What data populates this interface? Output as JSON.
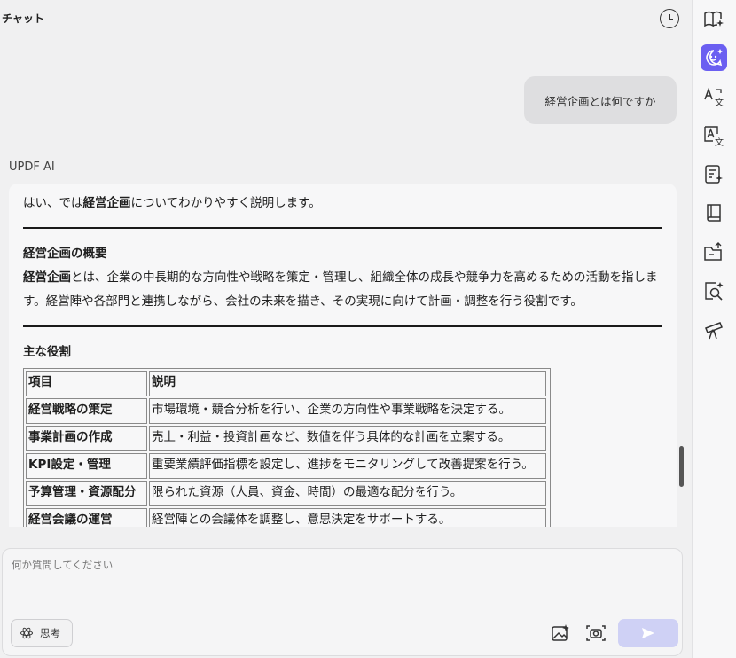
{
  "header": {
    "title": "チャット"
  },
  "conversation": {
    "user_message": "経営企画とは何ですか",
    "ai_name": "UPDF AI",
    "ai_intro_pre": "はい、では",
    "ai_intro_bold": "経営企画",
    "ai_intro_post": "についてわかりやすく説明します。",
    "section1_heading": "経営企画の概要",
    "section1_bold": "経営企画",
    "section1_text": "とは、企業の中長期的な方向性や戦略を策定・管理し、組織全体の成長や競争力を高めるための活動を指します。経営陣や各部門と連携しながら、会社の未来を描き、その実現に向けて計画・調整を行う役割です。",
    "section2_heading": "主な役割",
    "table": {
      "header": [
        "項目",
        "説明"
      ],
      "rows": [
        [
          "経営戦略の策定",
          "市場環境・競合分析を行い、企業の方向性や事業戦略を決定する。"
        ],
        [
          "事業計画の作成",
          "売上・利益・投資計画など、数値を伴う具体的な計画を立案する。"
        ],
        [
          "KPI設定・管理",
          "重要業績評価指標を設定し、進捗をモニタリングして改善提案を行う。"
        ],
        [
          "予算管理・資源配分",
          "限られた資源（人員、資金、時間）の最適な配分を行う。"
        ],
        [
          "経営会議の運営",
          "経営陣との会議体を調整し、意思決定をサポートする。"
        ]
      ]
    }
  },
  "input": {
    "placeholder": "何か質問してください",
    "think_label": "思考"
  },
  "colors": {
    "accent": "#6b5ff1",
    "send_disabled": "#cfd1f5",
    "user_bubble": "#dedee0"
  },
  "sidebar": {
    "icons": [
      "book-sparkle-icon",
      "ai-chat-icon",
      "translate-icon",
      "translate-box-icon",
      "document-sparkle-icon",
      "book-icon",
      "folder-upload-icon",
      "search-sparkle-icon",
      "telescope-icon"
    ]
  }
}
